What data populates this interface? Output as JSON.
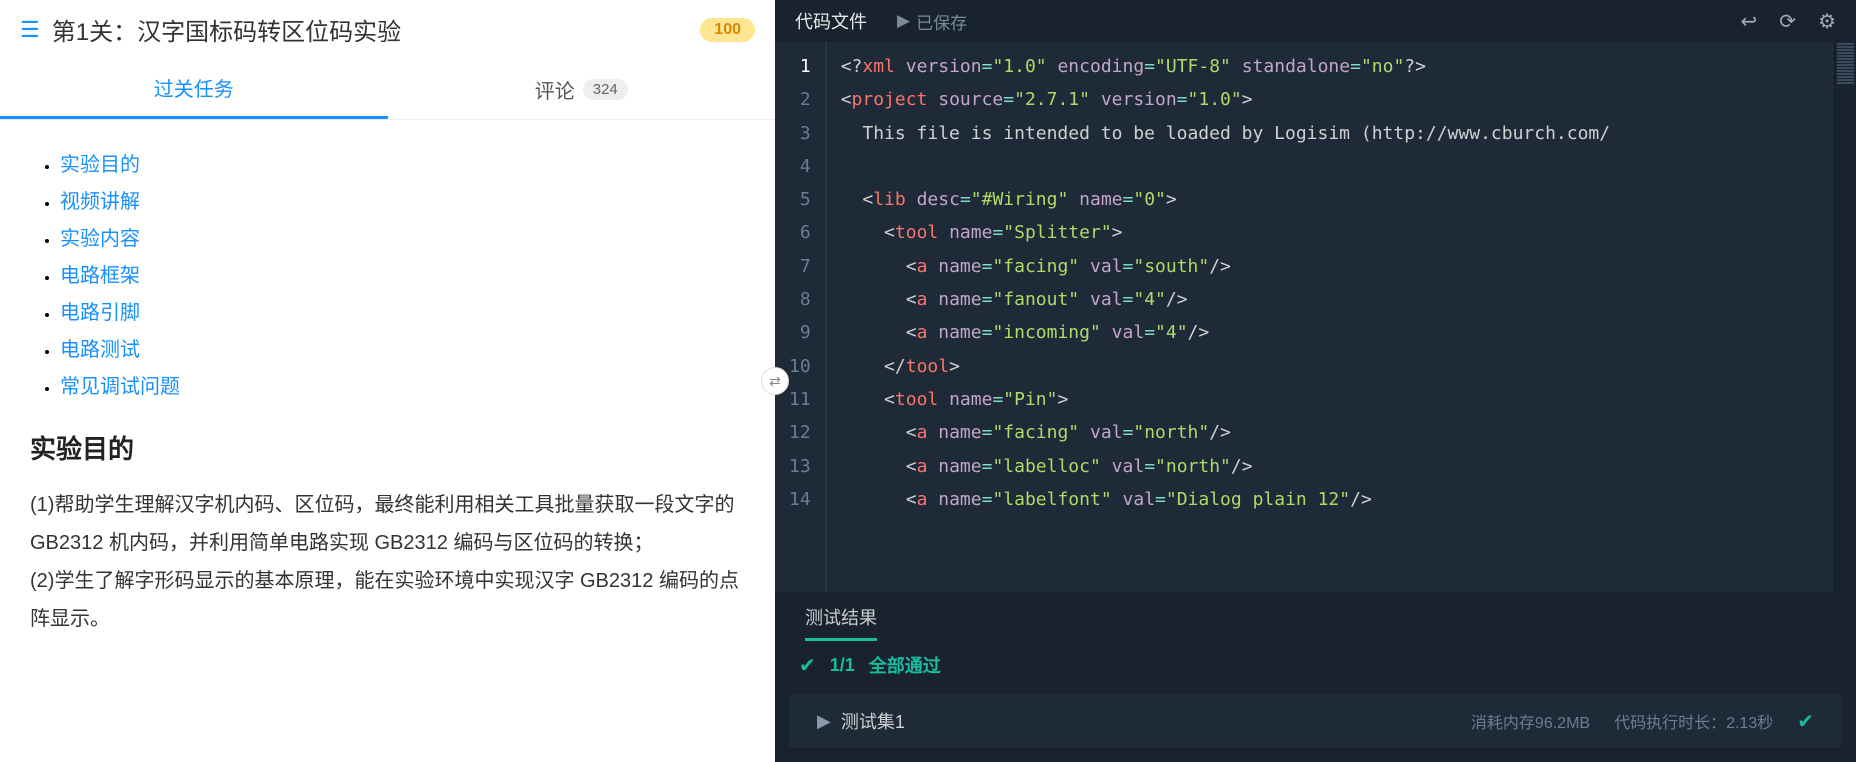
{
  "header": {
    "title": "第1关：汉字国标码转区位码实验",
    "score": "100"
  },
  "tabs": {
    "task": "过关任务",
    "comments": "评论",
    "comment_count": "324"
  },
  "toc": [
    "实验目的",
    "视频讲解",
    "实验内容",
    "电路框架",
    "电路引脚",
    "电路测试",
    "常见调试问题"
  ],
  "section": {
    "title": "实验目的",
    "p1": "(1)帮助学生理解汉字机内码、区位码，最终能利用相关工具批量获取一段文字的 GB2312 机内码，并利用简单电路实现 GB2312 编码与区位码的转换；",
    "p2": "(2)学生了解字形码显示的基本原理，能在实验环境中实现汉字 GB2312 编码的点阵显示。"
  },
  "editor": {
    "file_label": "代码文件",
    "saved": "已保存"
  },
  "code": {
    "lines": [
      1,
      2,
      3,
      4,
      5,
      6,
      7,
      8,
      9,
      10,
      11,
      12,
      13,
      14
    ],
    "l3": "  This file is intended to be loaded by Logisim (http://www.cburch.com/"
  },
  "xml": {
    "version": "\"1.0\"",
    "encoding": "\"UTF-8\"",
    "standalone": "\"no\"",
    "proj_source": "\"2.7.1\"",
    "proj_version": "\"1.0\"",
    "lib_desc": "\"#Wiring\"",
    "lib_name": "\"0\"",
    "tool_splitter": "\"Splitter\"",
    "tool_pin": "\"Pin\"",
    "facing": "\"facing\"",
    "south": "\"south\"",
    "north": "\"north\"",
    "fanout": "\"fanout\"",
    "incoming": "\"incoming\"",
    "four": "\"4\"",
    "labelloc": "\"labelloc\"",
    "labelfont": "\"labelfont\"",
    "font": "\"Dialog plain 12\""
  },
  "results": {
    "tab": "测试结果",
    "fraction": "1/1",
    "all_pass": "全部通过",
    "set_name": "测试集1",
    "mem": "消耗内存96.2MB",
    "time": "代码执行时长：2.13秒"
  }
}
